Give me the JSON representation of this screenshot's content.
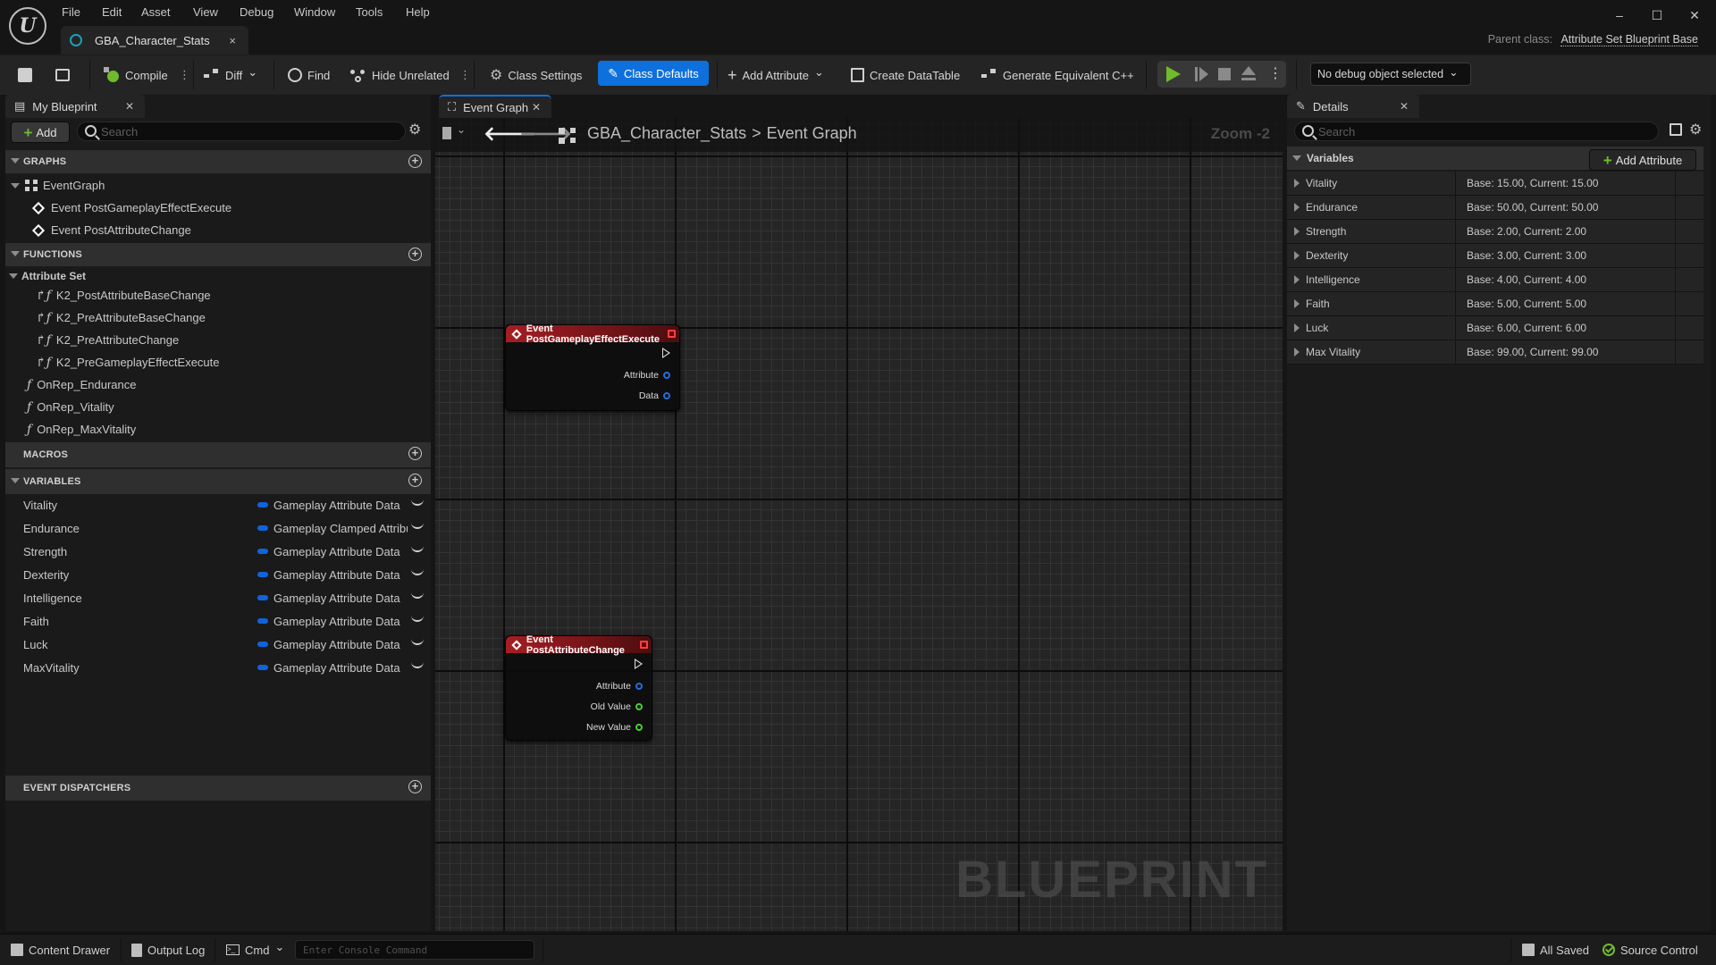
{
  "menu": [
    "File",
    "Edit",
    "Asset",
    "View",
    "Debug",
    "Window",
    "Tools",
    "Help"
  ],
  "document_tab": {
    "title": "GBA_Character_Stats",
    "close": "×"
  },
  "window_controls": {
    "minimize": "–",
    "maximize": "☐",
    "close": "✕"
  },
  "parent_class": {
    "label": "Parent class:",
    "value": "Attribute Set Blueprint Base"
  },
  "toolbar": {
    "compile": "Compile",
    "diff": "Diff",
    "find": "Find",
    "hide_unrelated": "Hide Unrelated",
    "class_settings": "Class Settings",
    "class_defaults": "Class Defaults",
    "add_attribute": "Add Attribute",
    "create_datatable": "Create DataTable",
    "generate_cpp": "Generate Equivalent C++",
    "debug_object": "No debug object selected",
    "kebab": "⋮",
    "chevron": "⌄"
  },
  "my_blueprint": {
    "tab_label": "My Blueprint",
    "add_label": "Add",
    "search_placeholder": "Search",
    "sections": {
      "graphs": "GRAPHS",
      "functions": "FUNCTIONS",
      "macros": "MACROS",
      "variables": "VARIABLES",
      "event_dispatchers": "EVENT DISPATCHERS"
    },
    "graphs": {
      "name": "EventGraph",
      "events": [
        "Event PostGameplayEffectExecute",
        "Event PostAttributeChange"
      ]
    },
    "functions": {
      "category": "Attribute Set",
      "overrides": [
        "K2_PostAttributeBaseChange",
        "K2_PreAttributeBaseChange",
        "K2_PreAttributeChange",
        "K2_PreGameplayEffectExecute"
      ],
      "items": [
        "OnRep_Endurance",
        "OnRep_Vitality",
        "OnRep_MaxVitality"
      ]
    },
    "variables": [
      {
        "name": "Vitality",
        "type": "Gameplay Attribute Data"
      },
      {
        "name": "Endurance",
        "type": "Gameplay Clamped Attribute Data"
      },
      {
        "name": "Strength",
        "type": "Gameplay Attribute Data"
      },
      {
        "name": "Dexterity",
        "type": "Gameplay Attribute Data"
      },
      {
        "name": "Intelligence",
        "type": "Gameplay Attribute Data"
      },
      {
        "name": "Faith",
        "type": "Gameplay Attribute Data"
      },
      {
        "name": "Luck",
        "type": "Gameplay Attribute Data"
      },
      {
        "name": "MaxVitality",
        "type": "Gameplay Attribute Data"
      }
    ]
  },
  "graph": {
    "tab_label": "Event Graph",
    "breadcrumb": [
      "GBA_Character_Stats",
      "Event Graph"
    ],
    "breadcrumb_sep": ">",
    "zoom": "Zoom -2",
    "watermark": "BLUEPRINT",
    "nodes": [
      {
        "title": "Event PostGameplayEffectExecute",
        "pins": [
          {
            "label": "Attribute",
            "color": "#1f6fe0"
          },
          {
            "label": "Data",
            "color": "#1f6fe0"
          }
        ]
      },
      {
        "title": "Event PostAttributeChange",
        "pins": [
          {
            "label": "Attribute",
            "color": "#1f6fe0"
          },
          {
            "label": "Old Value",
            "color": "#44d22e"
          },
          {
            "label": "New Value",
            "color": "#44d22e"
          }
        ]
      }
    ]
  },
  "details": {
    "tab_label": "Details",
    "search_placeholder": "Search",
    "section": "Variables",
    "add_attribute": "Add Attribute",
    "rows": [
      {
        "name": "Vitality",
        "value": "Base: 15.00, Current: 15.00"
      },
      {
        "name": "Endurance",
        "value": "Base: 50.00, Current: 50.00"
      },
      {
        "name": "Strength",
        "value": "Base: 2.00, Current: 2.00"
      },
      {
        "name": "Dexterity",
        "value": "Base: 3.00, Current: 3.00"
      },
      {
        "name": "Intelligence",
        "value": "Base: 4.00, Current: 4.00"
      },
      {
        "name": "Faith",
        "value": "Base: 5.00, Current: 5.00"
      },
      {
        "name": "Luck",
        "value": "Base: 6.00, Current: 6.00"
      },
      {
        "name": "Max Vitality",
        "value": "Base: 99.00, Current: 99.00"
      }
    ]
  },
  "statusbar": {
    "content_drawer": "Content Drawer",
    "output_log": "Output Log",
    "cmd": "Cmd",
    "console_placeholder": "Enter Console Command",
    "all_saved": "All Saved",
    "source_control": "Source Control"
  },
  "colors": {
    "accent": "#0e70dd",
    "event_node_header": "#a51e23",
    "struct_pin": "#1f6fe0",
    "float_pin": "#44d22e",
    "add_green": "#6fbb2c"
  }
}
